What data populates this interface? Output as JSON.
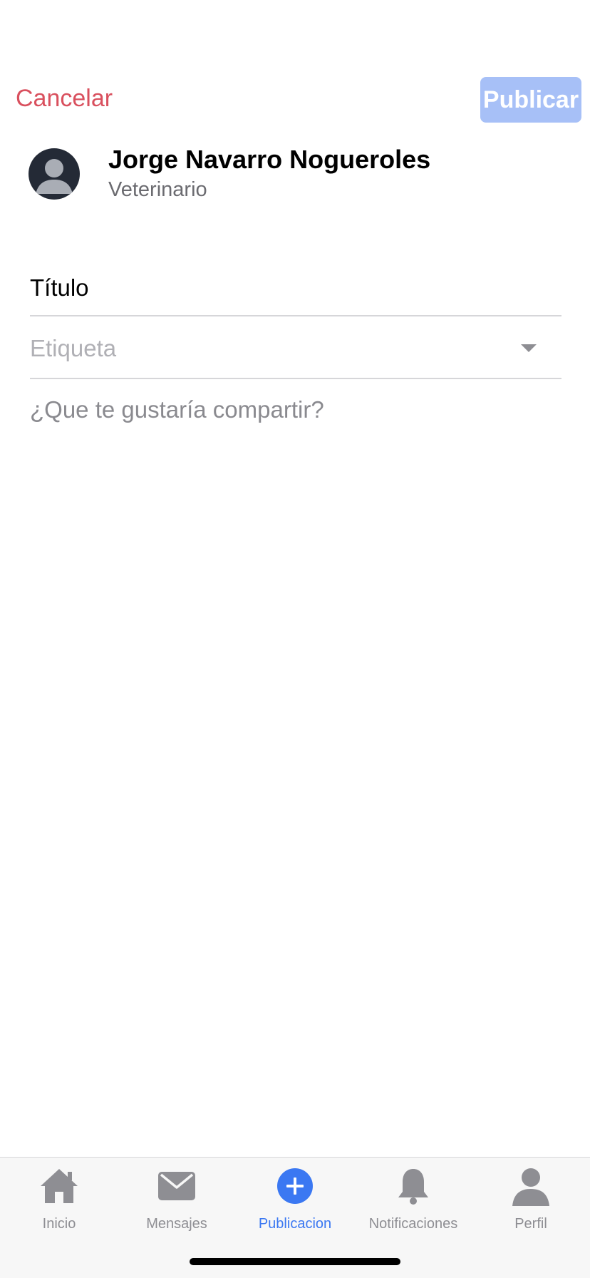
{
  "header": {
    "cancel_label": "Cancelar",
    "publish_label": "Publicar"
  },
  "user": {
    "name": "Jorge Navarro Nogueroles",
    "role": "Veterinario"
  },
  "form": {
    "title_value": "Título",
    "tag_placeholder": "Etiqueta",
    "share_placeholder": "¿Que te gustaría compartir?"
  },
  "tabs": [
    {
      "label": "Inicio",
      "icon": "home-icon"
    },
    {
      "label": "Mensajes",
      "icon": "envelope-icon"
    },
    {
      "label": "Publicacion",
      "icon": "plus-circle-icon",
      "active": true
    },
    {
      "label": "Notificaciones",
      "icon": "bell-icon"
    },
    {
      "label": "Perfil",
      "icon": "person-icon"
    }
  ],
  "colors": {
    "cancel": "#d9505e",
    "publish_disabled": "#a7c0f7",
    "accent": "#3b78f2",
    "inactive": "#8e8e93"
  }
}
